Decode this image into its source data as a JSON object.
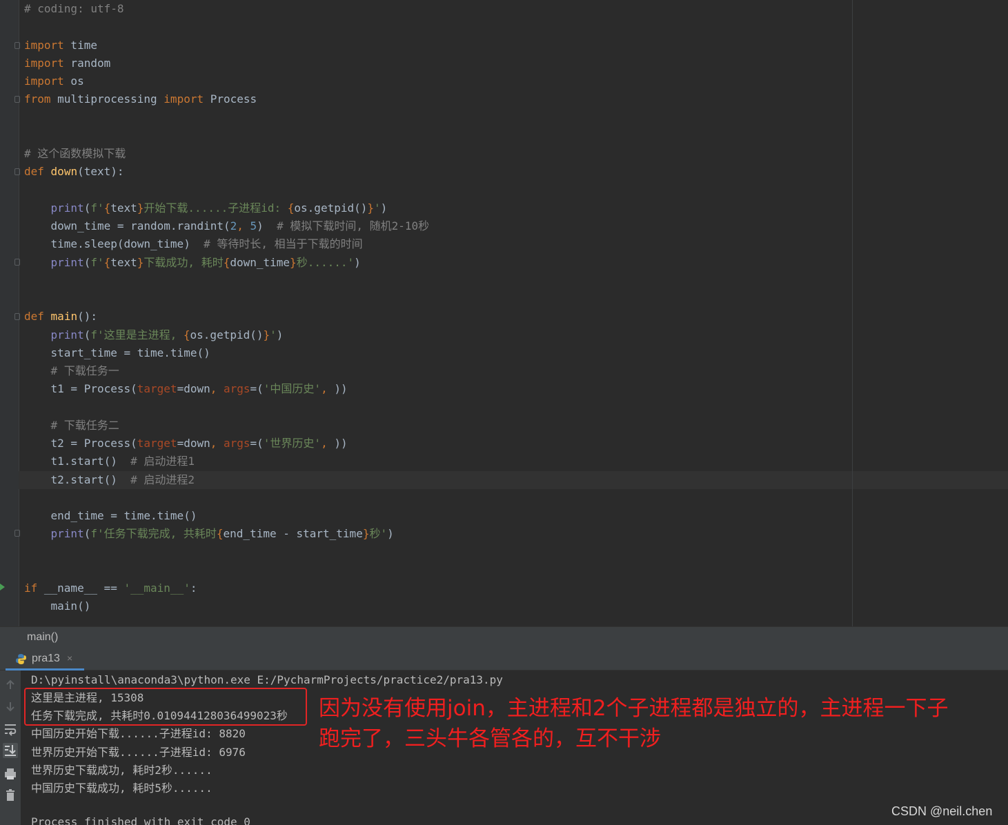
{
  "editor": {
    "lines": [
      {
        "tokens": [
          {
            "t": "# coding: utf-8",
            "c": "cm"
          }
        ]
      },
      {
        "tokens": [
          {
            "t": "import",
            "c": "kw"
          },
          {
            "t": " time",
            "c": ""
          }
        ]
      },
      {
        "tokens": [
          {
            "t": "import",
            "c": "kw"
          },
          {
            "t": " random",
            "c": ""
          }
        ]
      },
      {
        "tokens": [
          {
            "t": "import",
            "c": "kw"
          },
          {
            "t": " os",
            "c": ""
          }
        ]
      },
      {
        "tokens": [
          {
            "t": "from",
            "c": "kw"
          },
          {
            "t": " multiprocessing ",
            "c": ""
          },
          {
            "t": "import",
            "c": "kw"
          },
          {
            "t": " Process",
            "c": ""
          }
        ]
      },
      {
        "tokens": [
          {
            "t": "# 这个函数模拟下载",
            "c": "cm"
          }
        ]
      },
      {
        "tokens": [
          {
            "t": "def",
            "c": "kw"
          },
          {
            "t": " ",
            "c": ""
          },
          {
            "t": "down",
            "c": "fn"
          },
          {
            "t": "(text):",
            "c": ""
          }
        ]
      },
      {
        "tokens": [
          {
            "t": "    ",
            "c": ""
          },
          {
            "t": "print",
            "c": "bi"
          },
          {
            "t": "(",
            "c": ""
          },
          {
            "t": "f'",
            "c": "st"
          },
          {
            "t": "{",
            "c": "br"
          },
          {
            "t": "text",
            "c": ""
          },
          {
            "t": "}",
            "c": "br"
          },
          {
            "t": "开始下载......子进程id: ",
            "c": "st"
          },
          {
            "t": "{",
            "c": "br"
          },
          {
            "t": "os.getpid()",
            "c": ""
          },
          {
            "t": "}",
            "c": "br"
          },
          {
            "t": "'",
            "c": "st"
          },
          {
            "t": ")",
            "c": ""
          }
        ]
      },
      {
        "tokens": [
          {
            "t": "    down_time = random.randint(",
            "c": ""
          },
          {
            "t": "2",
            "c": "nu"
          },
          {
            "t": ", ",
            "c": "kw"
          },
          {
            "t": "5",
            "c": "nu"
          },
          {
            "t": ")  ",
            "c": ""
          },
          {
            "t": "# 模拟下载时间, 随机2-10秒",
            "c": "cm"
          }
        ]
      },
      {
        "tokens": [
          {
            "t": "    time.sleep(down_time)  ",
            "c": ""
          },
          {
            "t": "# 等待时长, 相当于下载的时间",
            "c": "cm"
          }
        ]
      },
      {
        "tokens": [
          {
            "t": "    ",
            "c": ""
          },
          {
            "t": "print",
            "c": "bi"
          },
          {
            "t": "(",
            "c": ""
          },
          {
            "t": "f'",
            "c": "st"
          },
          {
            "t": "{",
            "c": "br"
          },
          {
            "t": "text",
            "c": ""
          },
          {
            "t": "}",
            "c": "br"
          },
          {
            "t": "下载成功, 耗时",
            "c": "st"
          },
          {
            "t": "{",
            "c": "br"
          },
          {
            "t": "down_time",
            "c": ""
          },
          {
            "t": "}",
            "c": "br"
          },
          {
            "t": "秒......'",
            "c": "st"
          },
          {
            "t": ")",
            "c": ""
          }
        ]
      },
      {
        "tokens": [
          {
            "t": "def",
            "c": "kw"
          },
          {
            "t": " ",
            "c": ""
          },
          {
            "t": "main",
            "c": "fn"
          },
          {
            "t": "():",
            "c": ""
          }
        ]
      },
      {
        "tokens": [
          {
            "t": "    ",
            "c": ""
          },
          {
            "t": "print",
            "c": "bi"
          },
          {
            "t": "(",
            "c": ""
          },
          {
            "t": "f'这里是主进程, ",
            "c": "st"
          },
          {
            "t": "{",
            "c": "br"
          },
          {
            "t": "os.getpid()",
            "c": ""
          },
          {
            "t": "}",
            "c": "br"
          },
          {
            "t": "'",
            "c": "st"
          },
          {
            "t": ")",
            "c": ""
          }
        ]
      },
      {
        "tokens": [
          {
            "t": "    start_time = time.time()",
            "c": ""
          }
        ]
      },
      {
        "tokens": [
          {
            "t": "    ",
            "c": ""
          },
          {
            "t": "# 下载任务一",
            "c": "cm"
          }
        ]
      },
      {
        "tokens": [
          {
            "t": "    t1 = Process(",
            "c": ""
          },
          {
            "t": "target",
            "c": "pa"
          },
          {
            "t": "=down",
            "c": ""
          },
          {
            "t": ", ",
            "c": "kw"
          },
          {
            "t": "args",
            "c": "pa"
          },
          {
            "t": "=(",
            "c": ""
          },
          {
            "t": "'中国历史'",
            "c": "st"
          },
          {
            "t": ", ",
            "c": "kw"
          },
          {
            "t": "))",
            "c": ""
          }
        ]
      },
      {
        "tokens": [
          {
            "t": "    ",
            "c": ""
          },
          {
            "t": "# 下载任务二",
            "c": "cm"
          }
        ]
      },
      {
        "tokens": [
          {
            "t": "    t2 = Process(",
            "c": ""
          },
          {
            "t": "target",
            "c": "pa"
          },
          {
            "t": "=down",
            "c": ""
          },
          {
            "t": ", ",
            "c": "kw"
          },
          {
            "t": "args",
            "c": "pa"
          },
          {
            "t": "=(",
            "c": ""
          },
          {
            "t": "'世界历史'",
            "c": "st"
          },
          {
            "t": ", ",
            "c": "kw"
          },
          {
            "t": "))",
            "c": ""
          }
        ]
      },
      {
        "tokens": [
          {
            "t": "    t1.start()  ",
            "c": ""
          },
          {
            "t": "# 启动进程1",
            "c": "cm"
          }
        ]
      },
      {
        "tokens": [
          {
            "t": "    t2.start()  ",
            "c": ""
          },
          {
            "t": "# 启动进程2",
            "c": "cm"
          }
        ]
      },
      {
        "tokens": [
          {
            "t": "    end_time = time.time()",
            "c": ""
          }
        ]
      },
      {
        "tokens": [
          {
            "t": "    ",
            "c": ""
          },
          {
            "t": "print",
            "c": "bi"
          },
          {
            "t": "(",
            "c": ""
          },
          {
            "t": "f'任务下载完成, 共耗时",
            "c": "st"
          },
          {
            "t": "{",
            "c": "br"
          },
          {
            "t": "end_time - start_time",
            "c": ""
          },
          {
            "t": "}",
            "c": "br"
          },
          {
            "t": "秒'",
            "c": "st"
          },
          {
            "t": ")",
            "c": ""
          }
        ]
      },
      {
        "tokens": [
          {
            "t": "if",
            "c": "kw"
          },
          {
            "t": " __name__ == ",
            "c": ""
          },
          {
            "t": "'__main__'",
            "c": "st"
          },
          {
            "t": ":",
            "c": ""
          }
        ]
      },
      {
        "tokens": [
          {
            "t": "    main()",
            "c": ""
          }
        ]
      }
    ]
  },
  "breadcrumb": {
    "label": "main()"
  },
  "run": {
    "tab_label": "pra13",
    "tab_close": "×",
    "console_lines": [
      "D:\\pyinstall\\anaconda3\\python.exe E:/PycharmProjects/practice2/pra13.py",
      "这里是主进程, 15308",
      "任务下载完成, 共耗时0.010944128036499023秒",
      "中国历史开始下载......子进程id: 8820",
      "世界历史开始下载......子进程id: 6976",
      "世界历史下载成功, 耗时2秒......",
      "中国历史下载成功, 耗时5秒......",
      "Process finished with exit code 0"
    ],
    "toolbar_icons": [
      "arrow-up-icon",
      "arrow-down-icon",
      "soft-wrap-icon",
      "scroll-to-end-icon",
      "print-icon",
      "trash-icon"
    ]
  },
  "annotation": {
    "line1": "因为没有使用join，主进程和2个子进程都是独立的，主进程一下子",
    "line2": "跑完了，三头牛各管各的，互不干涉"
  },
  "watermark": "CSDN @neil.chen"
}
